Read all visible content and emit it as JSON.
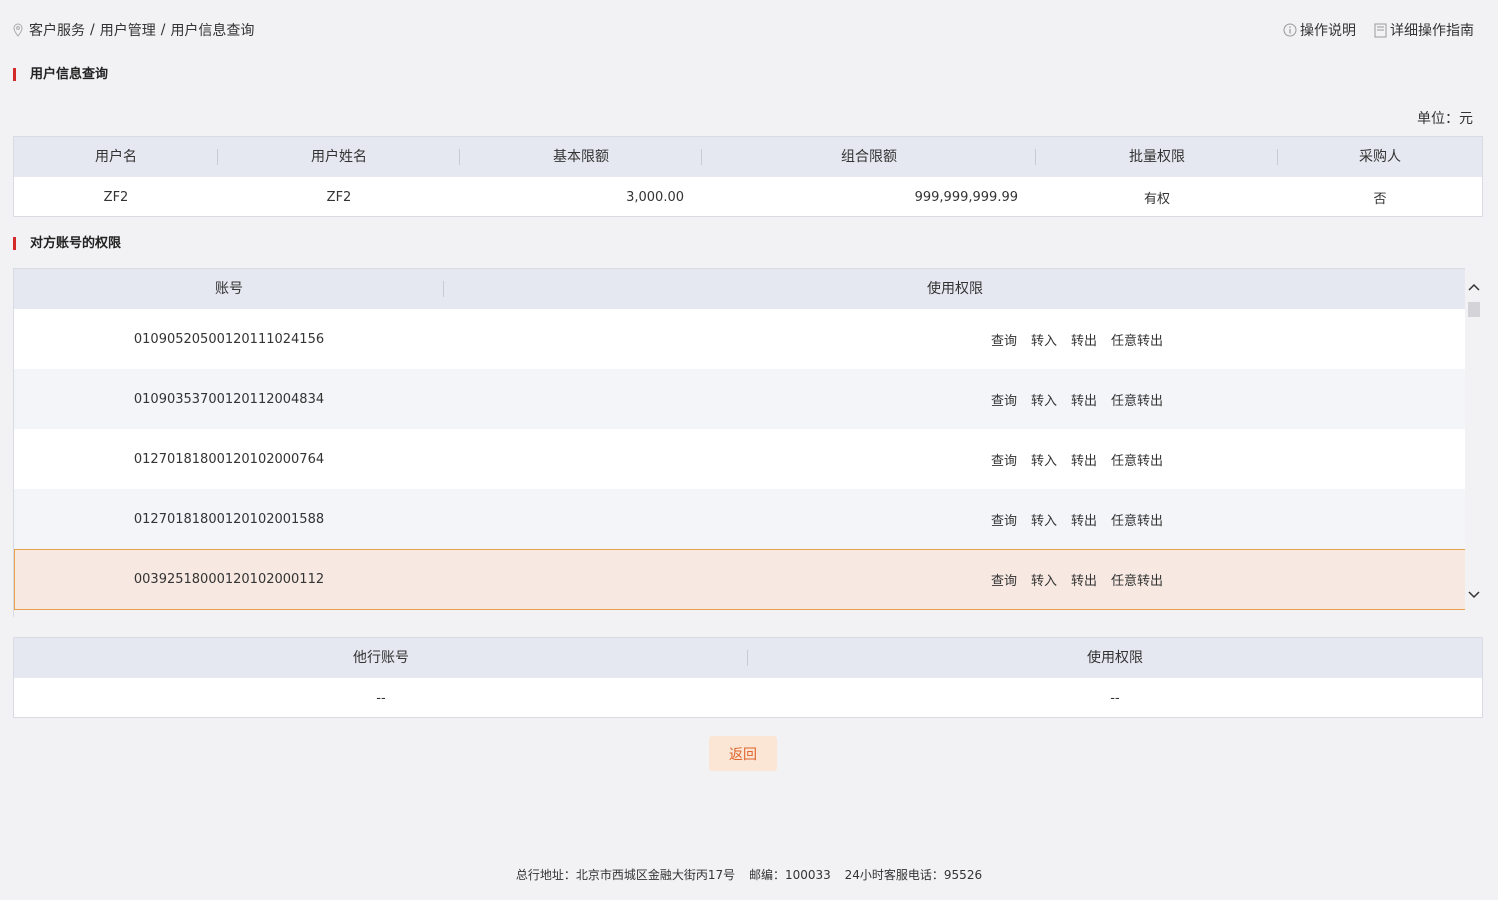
{
  "breadcrumb": [
    "客户服务",
    "用户管理",
    "用户信息查询"
  ],
  "breadcrumb_sep": "/",
  "help": {
    "explain": "操作说明",
    "guide": "详细操作指南"
  },
  "section_user": "用户信息查询",
  "unit": "单位：元",
  "user_table": {
    "headers": [
      "用户名",
      "用户姓名",
      "基本限额",
      "组合限额",
      "批量权限",
      "采购人"
    ],
    "row": [
      "ZF2",
      "ZF2",
      "3,000.00",
      "999,999,999.99",
      "有权",
      "否"
    ]
  },
  "section_acct": "对方账号的权限",
  "acct_table": {
    "headers": [
      "账号",
      "使用权限"
    ],
    "rows": [
      {
        "account": "01090520500120111024156",
        "perms": [
          "查询",
          "转入",
          "转出",
          "任意转出"
        ]
      },
      {
        "account": "01090353700120112004834",
        "perms": [
          "查询",
          "转入",
          "转出",
          "任意转出"
        ]
      },
      {
        "account": "01270181800120102000764",
        "perms": [
          "查询",
          "转入",
          "转出",
          "任意转出"
        ]
      },
      {
        "account": "01270181800120102001588",
        "perms": [
          "查询",
          "转入",
          "转出",
          "任意转出"
        ]
      },
      {
        "account": "00392518000120102000112",
        "perms": [
          "查询",
          "转入",
          "转出",
          "任意转出"
        ]
      }
    ],
    "selected_row": 4
  },
  "other_table": {
    "headers": [
      "他行账号",
      "使用权限"
    ],
    "row": [
      "--",
      "--"
    ]
  },
  "back_label": "返回",
  "footer": {
    "address": "总行地址：北京市西城区金融大街丙17号",
    "postcode": "邮编：100033",
    "hotline": "24小时客服电话：95526"
  },
  "colors": {
    "accent_red": "#d42a2a",
    "selected_row_bg": "#f7e9e2",
    "selected_border": "#e8a04a",
    "header_bg": "#e6e8f1",
    "button_bg": "#fbe6d6",
    "button_text": "#e0632a"
  }
}
